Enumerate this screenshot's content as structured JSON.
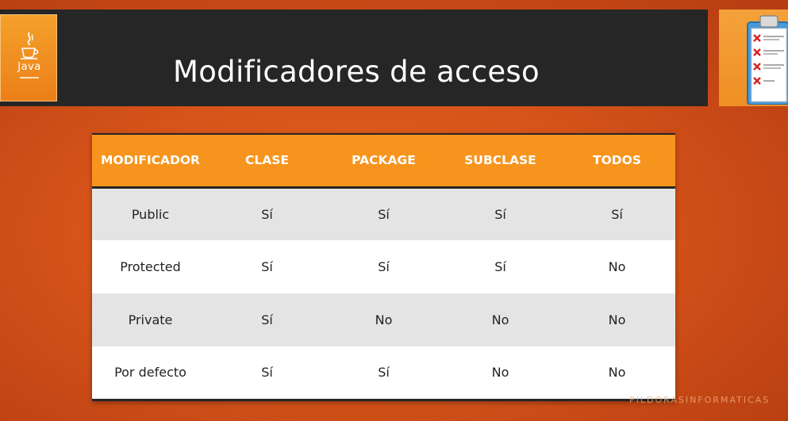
{
  "header": {
    "title": "Modificadores de acceso",
    "logo_text": "Java"
  },
  "table": {
    "columns": [
      "MODIFICADOR",
      "CLASE",
      "PACKAGE",
      "SUBCLASE",
      "TODOS"
    ],
    "rows": [
      [
        "Public",
        "Sí",
        "Sí",
        "Sí",
        "Sí"
      ],
      [
        "Protected",
        "Sí",
        "Sí",
        "Sí",
        "No"
      ],
      [
        "Private",
        "Sí",
        "No",
        "No",
        "No"
      ],
      [
        "Por defecto",
        "Sí",
        "Sí",
        "No",
        "No"
      ]
    ]
  },
  "watermark": "PILDORASINFORMATICAS",
  "icons": {
    "logo": "java-coffee-cup-icon",
    "checklist": "clipboard-checklist-icon"
  },
  "colors": {
    "background": "#d6531a",
    "title_bar": "#262626",
    "table_header": "#f7941d",
    "row_shaded": "#e4e4e4",
    "row_plain": "#ffffff"
  }
}
